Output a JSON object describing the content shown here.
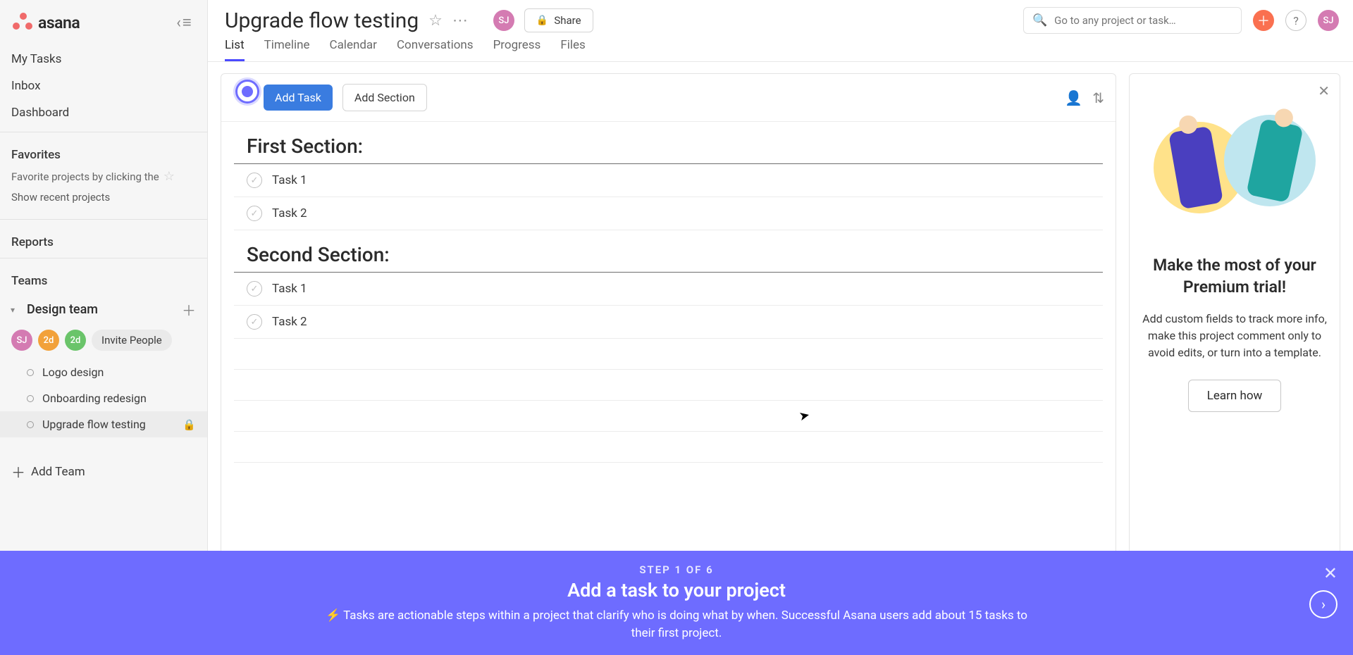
{
  "logo_text": "asana",
  "sidebar_nav": {
    "my_tasks": "My Tasks",
    "inbox": "Inbox",
    "dashboard": "Dashboard"
  },
  "favorites": {
    "label": "Favorites",
    "hint": "Favorite projects by clicking the",
    "recent": "Show recent projects"
  },
  "reports_label": "Reports",
  "teams_label": "Teams",
  "team": {
    "name": "Design team",
    "members": [
      "SJ",
      "2d",
      "2d"
    ],
    "invite": "Invite People",
    "projects": [
      {
        "name": "Logo design",
        "locked": false
      },
      {
        "name": "Onboarding redesign",
        "locked": false
      },
      {
        "name": "Upgrade flow testing",
        "locked": true
      }
    ]
  },
  "add_team": "Add Team",
  "header": {
    "title": "Upgrade flow testing",
    "avatar": "SJ",
    "share": "Share",
    "search_placeholder": "Go to any project or task…",
    "profile": "SJ"
  },
  "tabs": [
    "List",
    "Timeline",
    "Calendar",
    "Conversations",
    "Progress",
    "Files"
  ],
  "active_tab": "List",
  "toolbar": {
    "add_task": "Add Task",
    "add_section": "Add Section"
  },
  "sections": [
    {
      "title": "First Section:",
      "tasks": [
        "Task 1",
        "Task 2"
      ]
    },
    {
      "title": "Second Section:",
      "tasks": [
        "Task 1",
        "Task 2"
      ]
    }
  ],
  "promo": {
    "title": "Make the most of your Premium trial!",
    "body": "Add custom fields to track more info, make this project comment only to avoid edits, or turn into a template.",
    "cta": "Learn how"
  },
  "tutorial": {
    "step": "STEP 1 OF 6",
    "title": "Add a task to your project",
    "body": "⚡ Tasks are actionable steps within a project that clarify who is doing what by when. Successful Asana users add about 15 tasks to their first project."
  }
}
